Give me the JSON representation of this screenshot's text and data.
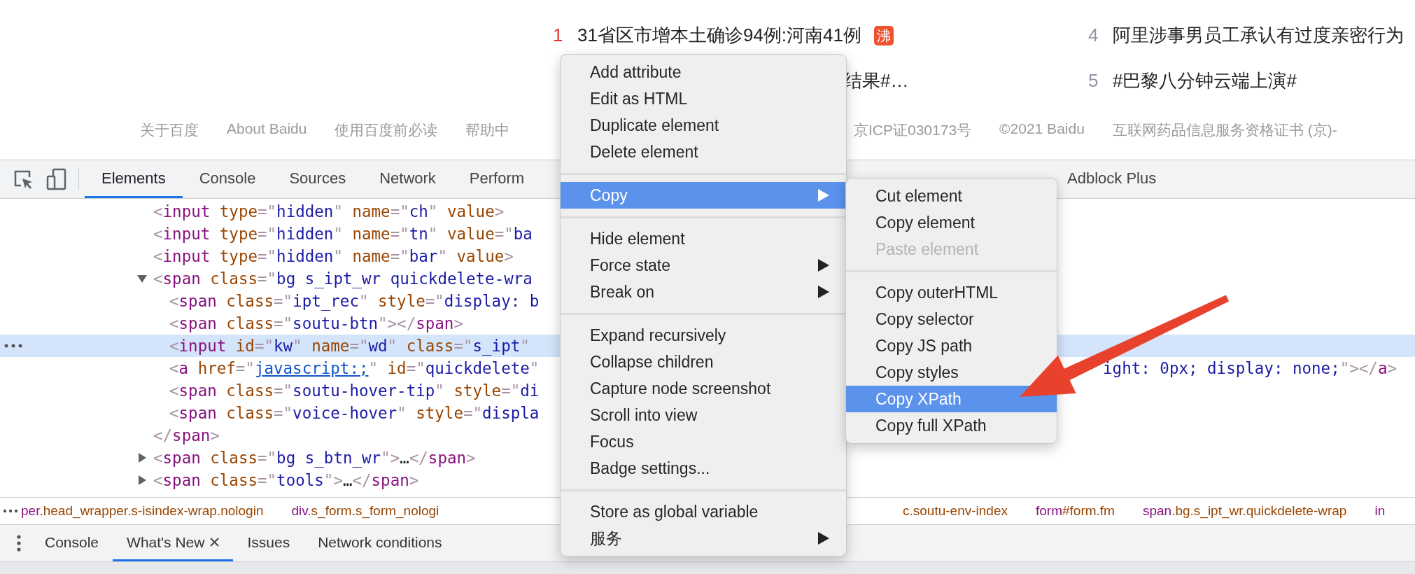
{
  "trending": [
    {
      "rank": "1",
      "color": "#e33e33",
      "text": "31省区市增本土确诊94例:河南41例",
      "badge": "沸",
      "covered": false
    },
    {
      "text": "结果#…",
      "covered": true
    },
    {
      "rank": "4",
      "color": "#9195a3",
      "text": "阿里涉事男员工承认有过度亲密行为",
      "covered": false
    },
    {
      "rank": "5",
      "color": "#9195a3",
      "text": "#巴黎八分钟云端上演#",
      "covered": false
    }
  ],
  "footer": {
    "left": [
      "关于百度",
      "About Baidu",
      "使用百度前必读",
      "帮助中"
    ],
    "right": [
      "京ICP证030173号",
      "©2021 Baidu",
      "互联网药品信息服务资格证书 (京)-"
    ]
  },
  "devtools": {
    "tabs": [
      {
        "label": "Elements",
        "selected": true
      },
      {
        "label": "Console",
        "selected": false
      },
      {
        "label": "Sources",
        "selected": false
      },
      {
        "label": "Network",
        "selected": false
      },
      {
        "label": "Perform",
        "selected": false
      }
    ],
    "tabs_right": [
      {
        "label": "Adblock Plus",
        "selected": false
      }
    ],
    "nodes": [
      {
        "text": "<input type=\"hidden\" name=\"ch\" value>",
        "selected": false
      },
      {
        "text": "<input type=\"hidden\" name=\"tn\" value=\"ba",
        "selected": false
      },
      {
        "text": "<input type=\"hidden\" name=\"bar\" value>",
        "selected": false
      },
      {
        "text": "<span class=\"bg s_ipt_wr quickdelete-wra",
        "selected": false,
        "expanded": true,
        "close": "</span>",
        "children": [
          {
            "text": "<span class=\"ipt_rec\" style=\"display: b",
            "selected": false
          },
          {
            "text": "<span class=\"soutu-btn\"></span>",
            "selected": false
          },
          {
            "text": "<input id=\"kw\" name=\"wd\" class=\"s_ipt\"",
            "selected": true
          },
          {
            "text": "<a href=\"javascript:;\" id=\"quickdelete\"",
            "link": true,
            "tail": "ight: 0px; display: none;\"></a>",
            "selected": false
          },
          {
            "text": "<span class=\"soutu-hover-tip\" style=\"di",
            "selected": false
          },
          {
            "text": "<span class=\"voice-hover\" style=\"displa",
            "selected": false
          }
        ]
      },
      {
        "text": "<span class=\"bg s_btn_wr\">…</span>",
        "selected": false,
        "expanded": false
      },
      {
        "text": "<span class=\"tools\">…</span>",
        "selected": false,
        "expanded": false
      }
    ],
    "breadcrumbs_left": [
      {
        "tag": "per",
        "rest": ".head_wrapper.s-isindex-wrap.nologin"
      },
      {
        "tag": "div",
        "rest": ".s_form.s_form_nologi"
      }
    ],
    "breadcrumbs_right": [
      {
        "rest": "c.soutu-env-index"
      },
      {
        "tag": "form",
        "rest": "#form.fm"
      },
      {
        "tag": "span",
        "rest": ".bg.s_ipt_wr.quickdelete-wrap"
      },
      {
        "tag": "in"
      }
    ],
    "drawer_tabs": [
      {
        "label": "Console",
        "selected": false,
        "closable": false
      },
      {
        "label": "What's New",
        "selected": true,
        "closable": true
      },
      {
        "label": "Issues",
        "selected": false,
        "closable": false
      },
      {
        "label": "Network conditions",
        "selected": false,
        "closable": false
      }
    ]
  },
  "context_menu": [
    {
      "kind": "item",
      "label": "Add attribute",
      "selected": false,
      "submenu": false
    },
    {
      "kind": "item",
      "label": "Edit as HTML",
      "selected": false,
      "submenu": false
    },
    {
      "kind": "item",
      "label": "Duplicate element",
      "selected": false,
      "submenu": false
    },
    {
      "kind": "item",
      "label": "Delete element",
      "selected": false,
      "submenu": false
    },
    {
      "kind": "separator"
    },
    {
      "kind": "item",
      "label": "Copy",
      "selected": true,
      "submenu": true
    },
    {
      "kind": "separator"
    },
    {
      "kind": "item",
      "label": "Hide element",
      "selected": false,
      "submenu": false
    },
    {
      "kind": "item",
      "label": "Force state",
      "selected": false,
      "submenu": true
    },
    {
      "kind": "item",
      "label": "Break on",
      "selected": false,
      "submenu": true
    },
    {
      "kind": "separator"
    },
    {
      "kind": "item",
      "label": "Expand recursively",
      "selected": false,
      "submenu": false
    },
    {
      "kind": "item",
      "label": "Collapse children",
      "selected": false,
      "submenu": false
    },
    {
      "kind": "item",
      "label": "Capture node screenshot",
      "selected": false,
      "submenu": false
    },
    {
      "kind": "item",
      "label": "Scroll into view",
      "selected": false,
      "submenu": false
    },
    {
      "kind": "item",
      "label": "Focus",
      "selected": false,
      "submenu": false
    },
    {
      "kind": "item",
      "label": "Badge settings...",
      "selected": false,
      "submenu": false
    },
    {
      "kind": "separator"
    },
    {
      "kind": "item",
      "label": "Store as global variable",
      "selected": false,
      "submenu": false
    },
    {
      "kind": "item",
      "label": "服务",
      "selected": false,
      "submenu": true
    }
  ],
  "copy_submenu": [
    {
      "kind": "item",
      "label": "Cut element",
      "selected": false,
      "disabled": false
    },
    {
      "kind": "item",
      "label": "Copy element",
      "selected": false,
      "disabled": false
    },
    {
      "kind": "item",
      "label": "Paste element",
      "selected": false,
      "disabled": true
    },
    {
      "kind": "separator"
    },
    {
      "kind": "item",
      "label": "Copy outerHTML",
      "selected": false,
      "disabled": false
    },
    {
      "kind": "item",
      "label": "Copy selector",
      "selected": false,
      "disabled": false
    },
    {
      "kind": "item",
      "label": "Copy JS path",
      "selected": false,
      "disabled": false
    },
    {
      "kind": "item",
      "label": "Copy styles",
      "selected": false,
      "disabled": false
    },
    {
      "kind": "item",
      "label": "Copy XPath",
      "selected": true,
      "disabled": false
    },
    {
      "kind": "item",
      "label": "Copy full XPath",
      "selected": false,
      "disabled": false
    }
  ]
}
